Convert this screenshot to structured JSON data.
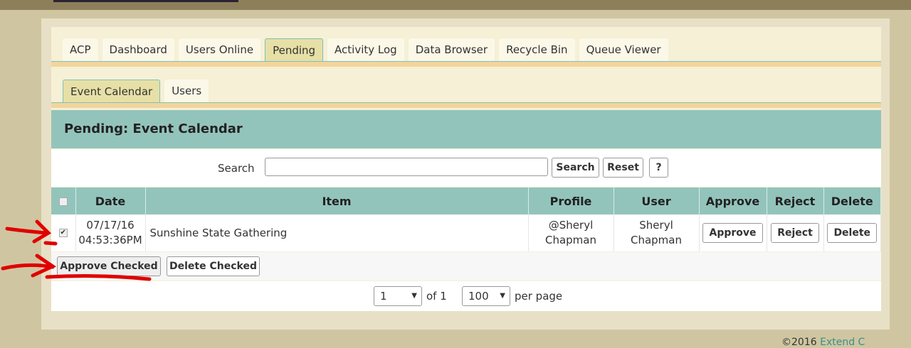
{
  "tabs": [
    {
      "label": "ACP"
    },
    {
      "label": "Dashboard"
    },
    {
      "label": "Users Online"
    },
    {
      "label": "Pending",
      "active": true
    },
    {
      "label": "Activity Log"
    },
    {
      "label": "Data Browser"
    },
    {
      "label": "Recycle Bin"
    },
    {
      "label": "Queue Viewer"
    }
  ],
  "subtabs": [
    {
      "label": "Event Calendar",
      "active": true
    },
    {
      "label": "Users"
    }
  ],
  "header": {
    "title": "Pending: Event Calendar"
  },
  "search": {
    "label": "Search",
    "value": "",
    "search_button": "Search",
    "reset_button": "Reset",
    "help_button": "?"
  },
  "table": {
    "columns": [
      "Date",
      "Item",
      "Profile",
      "User",
      "Approve",
      "Reject",
      "Delete"
    ],
    "rows": [
      {
        "checked": true,
        "date": "07/17/16",
        "time": "04:53:36PM",
        "item": "Sunshine State Gathering",
        "profile_1": "@Sheryl",
        "profile_2": "Chapman",
        "user_1": "Sheryl",
        "user_2": "Chapman",
        "approve": "Approve",
        "reject": "Reject",
        "delete": "Delete"
      }
    ]
  },
  "actions": {
    "approve_checked": "Approve Checked",
    "delete_checked": "Delete Checked"
  },
  "pagination": {
    "page": "1",
    "of_label": "of 1",
    "per_page_value": "100",
    "per_page_label": "per page"
  },
  "footer": {
    "copyright": "©2016",
    "link": "Extend C"
  },
  "colors": {
    "teal": "#93c4bc",
    "annotation": "#e00000"
  }
}
